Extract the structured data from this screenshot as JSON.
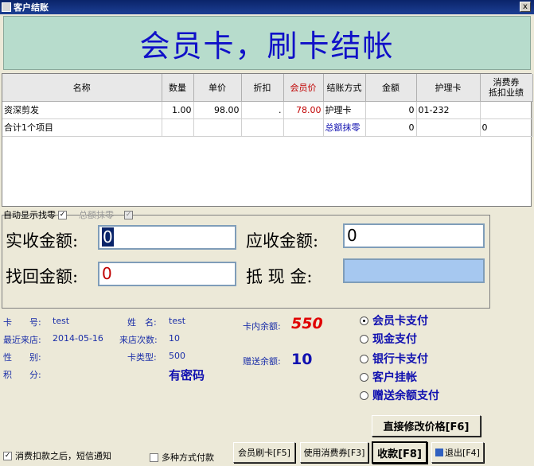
{
  "window": {
    "title": "客户结账",
    "close": "x"
  },
  "banner": {
    "text": "会员卡，刷卡结帐"
  },
  "table": {
    "headers": [
      "名称",
      "数量",
      "单价",
      "折扣",
      "会员价",
      "结账方式",
      "金额",
      "护理卡",
      "消费券\n抵扣业绩"
    ],
    "rows": [
      {
        "name": "资深剪发",
        "qty": "1.00",
        "price": "98.00",
        "discount": ".",
        "member_price": "78.00",
        "method": "护理卡",
        "amount": "0",
        "card": "01-232",
        "voucher": ""
      },
      {
        "name": "合计1个项目",
        "qty": "",
        "price": "",
        "discount": "",
        "member_price": "",
        "method": "总额抹零",
        "amount": "0",
        "card": "",
        "voucher": "0"
      }
    ]
  },
  "options": {
    "auto_change": "自动显示找零",
    "total_round": "总额抹零"
  },
  "amounts": {
    "actual_label": "实收金额:",
    "actual_value": "0",
    "due_label": "应收金额:",
    "due_value": "0",
    "change_label": "找回金额:",
    "change_value": "0",
    "cash_label": "抵 现 金:",
    "cash_value": ""
  },
  "member": {
    "card_no_label": "卡　　号:",
    "card_no": "test",
    "name_label": "姓　名:",
    "name": "test",
    "last_visit_label": "最近来店:",
    "last_visit": "2014-05-16",
    "visits_label": "来店次数:",
    "visits": "10",
    "gender_label": "性　　别:",
    "gender": "",
    "card_type_label": "卡类型:",
    "card_type": "500",
    "points_label": "积　　分:",
    "points": "",
    "password_text": "有密码",
    "card_balance_label": "卡内余额:",
    "card_balance": "550",
    "gift_balance_label": "赠送余额:",
    "gift_balance": "10"
  },
  "payment_methods": [
    "会员卡支付",
    "现金支付",
    "银行卡支付",
    "客户挂帐",
    "赠送余额支付"
  ],
  "buttons": {
    "modify_price": "直接修改价格[F6]",
    "swipe": "会员刷卡[F5]",
    "voucher": "使用消费券[F3]",
    "collect": "收款[F8]",
    "exit": "退出[F4]"
  },
  "bottom": {
    "sms": "消费扣款之后，短信通知",
    "multi": "多种方式付款"
  }
}
